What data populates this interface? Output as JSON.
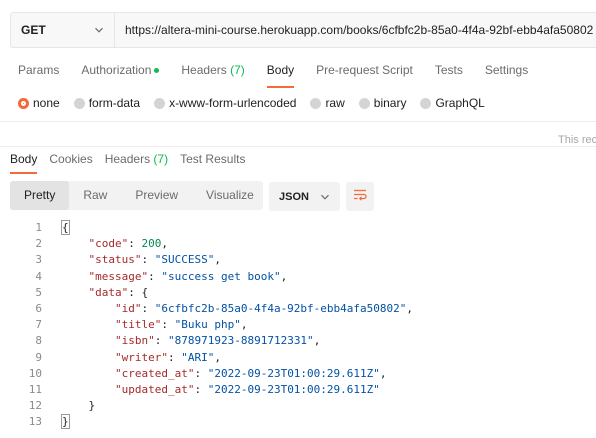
{
  "request": {
    "method": "GET",
    "url": "https://altera-mini-course.herokuapp.com/books/6cfbfc2b-85a0-4f4a-92bf-ebb4afa50802"
  },
  "request_tabs": [
    {
      "label": "Params"
    },
    {
      "label": "Authorization"
    },
    {
      "label": "Headers",
      "count": "(7)"
    },
    {
      "label": "Body"
    },
    {
      "label": "Pre-request Script"
    },
    {
      "label": "Tests"
    },
    {
      "label": "Settings"
    }
  ],
  "body_types": [
    "none",
    "form-data",
    "x-www-form-urlencoded",
    "raw",
    "binary",
    "GraphQL"
  ],
  "selected_body_type": "none",
  "truncated_notice": "This rec",
  "response_tabs": [
    {
      "label": "Body"
    },
    {
      "label": "Cookies"
    },
    {
      "label": "Headers",
      "count": "(7)"
    },
    {
      "label": "Test Results"
    }
  ],
  "view_modes": [
    "Pretty",
    "Raw",
    "Preview",
    "Visualize"
  ],
  "format": "JSON",
  "colors": {
    "accent": "#f26b3a",
    "ok": "#0cbb52",
    "string": "#0451a5",
    "key": "#a52a2a",
    "number": "#098658"
  },
  "code_lines": [
    {
      "n": "1"
    },
    {
      "n": "2"
    },
    {
      "n": "3"
    },
    {
      "n": "4"
    },
    {
      "n": "5"
    },
    {
      "n": "6"
    },
    {
      "n": "7"
    },
    {
      "n": "8"
    },
    {
      "n": "9"
    },
    {
      "n": "10"
    },
    {
      "n": "11"
    },
    {
      "n": "12"
    },
    {
      "n": "13"
    }
  ],
  "response": {
    "code_key": "\"code\"",
    "code_val": "200",
    "status_key": "\"status\"",
    "status_val": "\"SUCCESS\"",
    "message_key": "\"message\"",
    "message_val": "\"success get book\"",
    "data_key": "\"data\"",
    "id_key": "\"id\"",
    "id_val": "\"6cfbfc2b-85a0-4f4a-92bf-ebb4afa50802\"",
    "title_key": "\"title\"",
    "title_val": "\"Buku php\"",
    "isbn_key": "\"isbn\"",
    "isbn_val": "\"878971923-8891712331\"",
    "writer_key": "\"writer\"",
    "writer_val": "\"ARI\"",
    "created_key": "\"created_at\"",
    "created_val": "\"2022-09-23T01:00:29.611Z\"",
    "updated_key": "\"updated_at\"",
    "updated_val": "\"2022-09-23T01:00:29.611Z\""
  }
}
